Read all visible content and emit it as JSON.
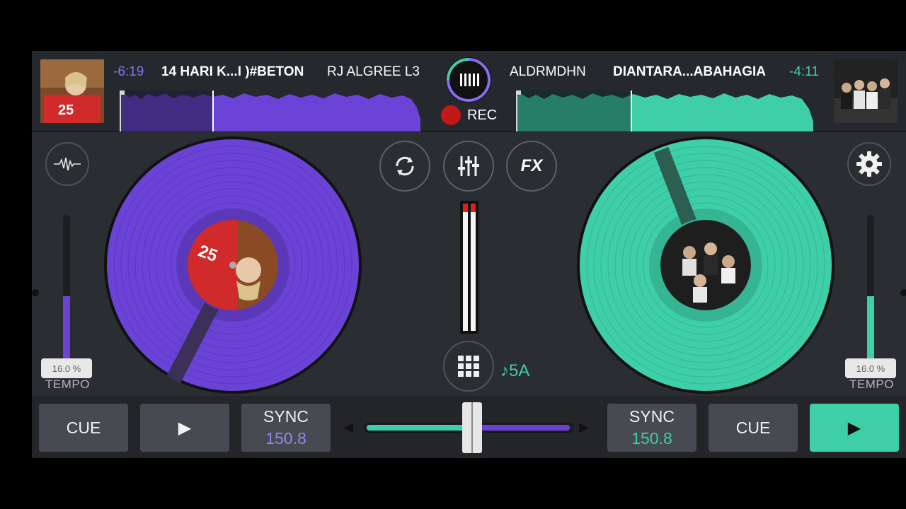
{
  "deck_a": {
    "time": "-6:19",
    "title": "14 HARI K...I )#BETON",
    "artist": "RJ ALGREE L3",
    "tempo_pct": "16.0 %",
    "tempo_label": "TEMPO",
    "tempo_level": 0.45,
    "sync_label": "SYNC",
    "bpm": "150.8",
    "cue_label": "CUE",
    "color": "#6a42d6"
  },
  "deck_b": {
    "time": "-4:11",
    "title": "DIANTARA...ABAHAGIA",
    "artist": "ALDRMDHN",
    "tempo_pct": "16.0 %",
    "tempo_label": "TEMPO",
    "tempo_level": 0.45,
    "sync_label": "SYNC",
    "bpm": "150.8",
    "cue_label": "CUE",
    "color": "#3ecfa9"
  },
  "center": {
    "rec_label": "REC",
    "key": "♪5A",
    "fx_label": "FX",
    "crossfader_position": 0.52
  },
  "icons": {
    "play": "▶",
    "left_arrow": "◀",
    "right_arrow": "▶"
  }
}
